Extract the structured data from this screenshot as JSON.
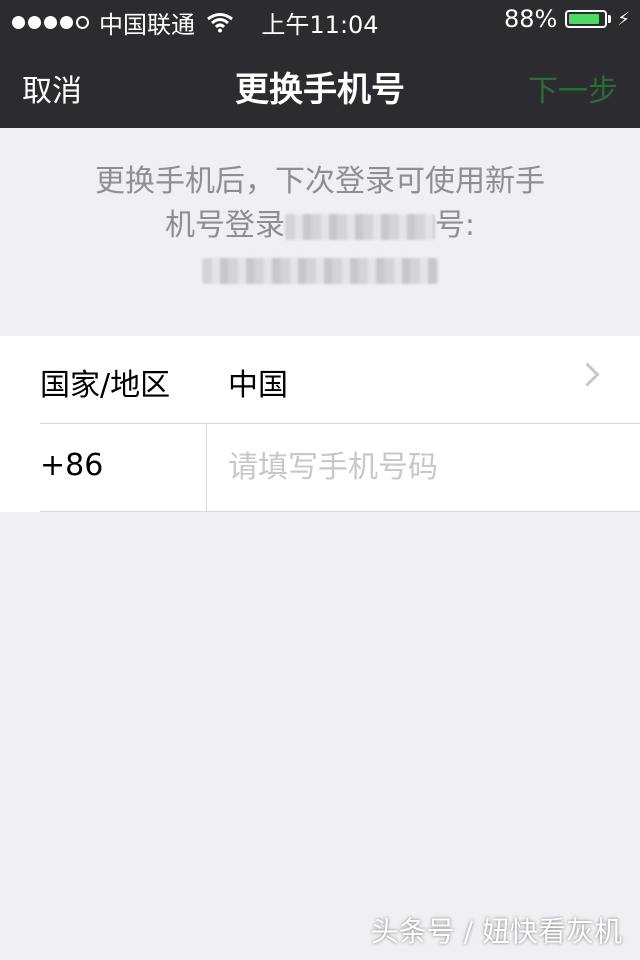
{
  "status_bar": {
    "carrier": "中国联通",
    "time": "上午11:04",
    "battery": "88%",
    "battery_level": 0.88,
    "signal_dots": 5,
    "signal_filled": 4
  },
  "nav": {
    "cancel": "取消",
    "title": "更换手机号",
    "next": "下一步"
  },
  "info": {
    "line1": "更换手机后，下次登录可使用新手",
    "line2_a": "机号登录",
    "line2_b": "号:"
  },
  "form": {
    "region_label": "国家/地区",
    "region_value": "中国",
    "country_code": "+86",
    "phone_placeholder": "请填写手机号码"
  },
  "watermark": "头条号 / 妞快看灰机",
  "colors": {
    "nav_bg": "#2c2c30",
    "next_disabled": "#2c6b35",
    "page_bg": "#efeff4",
    "battery": "#4cd964"
  }
}
